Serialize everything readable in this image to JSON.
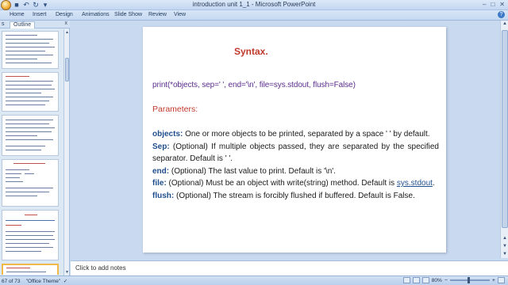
{
  "window": {
    "title": "introduction unit 1_1 - Microsoft PowerPoint"
  },
  "ribbon": {
    "tabs": [
      "Home",
      "Insert",
      "Design",
      "Animations",
      "Slide Show",
      "Review",
      "View"
    ]
  },
  "left_pane": {
    "tab_slides": "s",
    "tab_outline": "Outline",
    "close": "x"
  },
  "slide": {
    "title": "Syntax.",
    "syntax": "print(*objects, sep=' ', end='\\n', file=sys.stdout, flush=False)",
    "params_heading": "Parameters:",
    "params": [
      {
        "name": "objects:",
        "text": " One or more objects to be printed, separated by a space ' ' by default."
      },
      {
        "name": "Sep:",
        "text": " (Optional) If multiple objects passed, they are separated by the specified separator. Default is ' '."
      },
      {
        "name": "end:",
        "text": " (Optional) The last value to print. Default is '\\n'."
      },
      {
        "name": "file:",
        "text": " (Optional) Must be an object with write(string) method. Default is ",
        "link": "sys.stdout",
        "after": "."
      },
      {
        "name": "flush:",
        "text": " (Optional) The stream is forcibly flushed if buffered. Default is False."
      }
    ]
  },
  "notes": {
    "placeholder": "Click to add notes"
  },
  "status": {
    "slide_info": "67 of 73",
    "theme": "\"Office Theme\"",
    "zoom": "80%"
  },
  "colors": {
    "title": "#c0392b",
    "syntax": "#5b2d8c",
    "keyword": "#1f4e8c"
  }
}
